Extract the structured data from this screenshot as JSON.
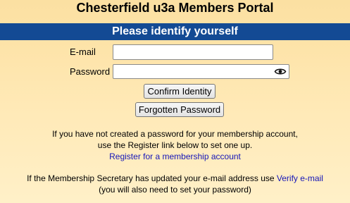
{
  "header": {
    "title": "Chesterfield u3a Members Portal",
    "banner": "Please identify yourself"
  },
  "form": {
    "email_label": "E-mail",
    "email_value": "",
    "password_label": "Password",
    "password_value": "",
    "confirm_button": "Confirm Identity",
    "forgot_button": "Forgotten Password"
  },
  "info": {
    "line1": "If you have not created a password for your membership account,",
    "line2": "use the Register link below to set one up.",
    "register_link": "Register for a membership account",
    "verify_text": "If the Membership Secretary has updated your e-mail address use ",
    "verify_link": "Verify e-mail",
    "verify_note": "(you will also need to set your password)"
  },
  "colors": {
    "banner": "#134a94",
    "link": "#1515b8",
    "background_top": "#fbe0a2",
    "background_bottom": "#fff0c8"
  },
  "icons": {
    "password_toggle": "eye-icon"
  }
}
